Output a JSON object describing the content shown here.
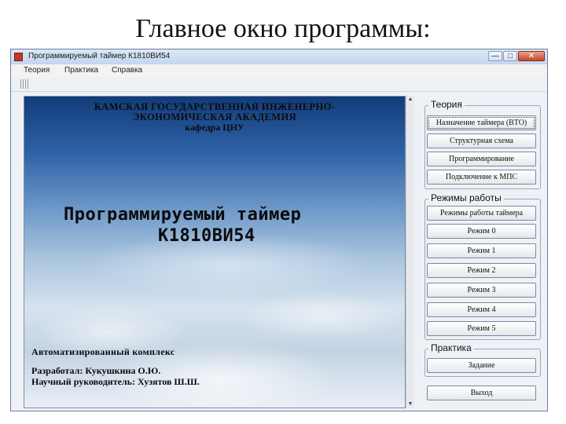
{
  "slide_title": "Главное окно программы:",
  "window": {
    "title": "Программируемый таймер К1810ВИ54",
    "controls": {
      "minimize": "—",
      "maximize": "□",
      "close": "✕"
    }
  },
  "menu": [
    "Теория",
    "Практика",
    "Справка"
  ],
  "picture": {
    "institution": [
      "КАМСКАЯ ГОСУДАРСТВЕННАЯ ИНЖЕНЕРНО-",
      "ЭКОНОМИЧЕСКАЯ АКАДЕМИЯ",
      "кафедра ЦНУ"
    ],
    "heading": [
      "Программируемый таймер",
      "К1810ВИ54"
    ],
    "footer": [
      "Автоматизированный комплекс",
      "Разработал: Кукушкина О.Ю.",
      "Научный руководитель: Хузятов Ш.Ш."
    ]
  },
  "panel": {
    "theory": {
      "legend": "Теория",
      "buttons": [
        "Назначение таймера (ВТО)",
        "Структурная схема",
        "Программирование",
        "Подключение к МПС"
      ]
    },
    "modes": {
      "legend": "Режимы работы",
      "buttons": [
        "Режимы работы таймера",
        "Режим 0",
        "Режим 1",
        "Режим 2",
        "Режим 3",
        "Режим 4",
        "Режим 5"
      ]
    },
    "practice": {
      "legend": "Практика",
      "buttons": [
        "Задание"
      ]
    },
    "exit_button": "Выход"
  },
  "icons": {
    "app": "app-icon",
    "toolbar": "toolbar-grip-icon",
    "scroll_up": "scroll-up-arrow-icon",
    "scroll_down": "scroll-down-arrow-icon"
  }
}
